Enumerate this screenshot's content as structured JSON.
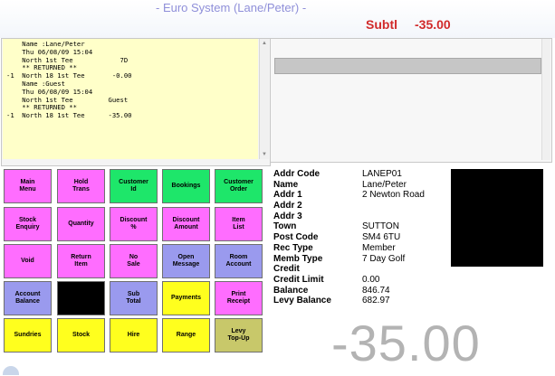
{
  "header": {
    "title": "- Euro System (Lane/Peter) -",
    "subtotal_label": "Subtl",
    "subtotal_value": "-35.00"
  },
  "receipt": {
    "lines": [
      "    Name :Lane/Peter",
      "    Thu 06/08/09 15:04",
      "    North 1st Tee            7D",
      "    ** RETURNED **",
      "-1  North 18 1st Tee       -0.00",
      "    Name :Guest",
      "    Thu 06/08/09 15:04",
      "    North 1st Tee         Guest",
      "    ** RETURNED **",
      "-1  North 18 1st Tee      -35.00"
    ]
  },
  "buttons": [
    {
      "label": "Main\nMenu",
      "color": "#ff6dff"
    },
    {
      "label": "Hold\nTrans",
      "color": "#ff6dff"
    },
    {
      "label": "Customer\nId",
      "color": "#1ee66a"
    },
    {
      "label": "Bookings",
      "color": "#1ee66a"
    },
    {
      "label": "Customer\nOrder",
      "color": "#1ee66a"
    },
    {
      "label": "Stock\nEnquiry",
      "color": "#ff6dff"
    },
    {
      "label": "Quantity",
      "color": "#ff6dff"
    },
    {
      "label": "Discount\n%",
      "color": "#ff6dff"
    },
    {
      "label": "Discount\nAmount",
      "color": "#ff6dff"
    },
    {
      "label": "Item\nList",
      "color": "#ff6dff"
    },
    {
      "label": "Void",
      "color": "#ff6dff"
    },
    {
      "label": "Return\nItem",
      "color": "#ff6dff"
    },
    {
      "label": "No\nSale",
      "color": "#ff6dff"
    },
    {
      "label": "Open\nMessage",
      "color": "#9a9aee"
    },
    {
      "label": "Room\nAccount",
      "color": "#9a9aee"
    },
    {
      "label": "Account\nBalance",
      "color": "#9a9aee"
    },
    {
      "label": "",
      "color": "#000000"
    },
    {
      "label": "Sub\nTotal",
      "color": "#9a9aee"
    },
    {
      "label": "Payments",
      "color": "#ffff1e"
    },
    {
      "label": "Print\nReceipt",
      "color": "#ff6dff"
    },
    {
      "label": "Sundries",
      "color": "#ffff1e"
    },
    {
      "label": "Stock",
      "color": "#ffff1e"
    },
    {
      "label": "Hire",
      "color": "#ffff1e"
    },
    {
      "label": "Range",
      "color": "#ffff1e"
    },
    {
      "label": "Levy\nTop-Up",
      "color": "#c8c86a"
    }
  ],
  "customer": {
    "rows": [
      {
        "label": "Addr Code",
        "value": "LANEP01"
      },
      {
        "label": "Name",
        "value": "Lane/Peter"
      },
      {
        "label": "Addr 1",
        "value": "2 Newton Road"
      },
      {
        "label": "Addr 2",
        "value": ""
      },
      {
        "label": "Addr 3",
        "value": ""
      },
      {
        "label": "Town",
        "value": "SUTTON"
      },
      {
        "label": "Post Code",
        "value": "SM4 6TU"
      },
      {
        "label": "Rec Type",
        "value": "Member"
      },
      {
        "label": "Memb Type",
        "value": "7 Day Golf"
      },
      {
        "label": "Credit",
        "value": ""
      },
      {
        "label": "Credit Limit",
        "value": "0.00"
      },
      {
        "label": "Balance",
        "value": "846.74"
      },
      {
        "label": "Levy Balance",
        "value": "682.97"
      }
    ]
  },
  "total_display": "-35.00",
  "icons": {
    "scroll_up": "scroll-up-arrow-icon",
    "scroll_down": "scroll-down-arrow-icon"
  }
}
